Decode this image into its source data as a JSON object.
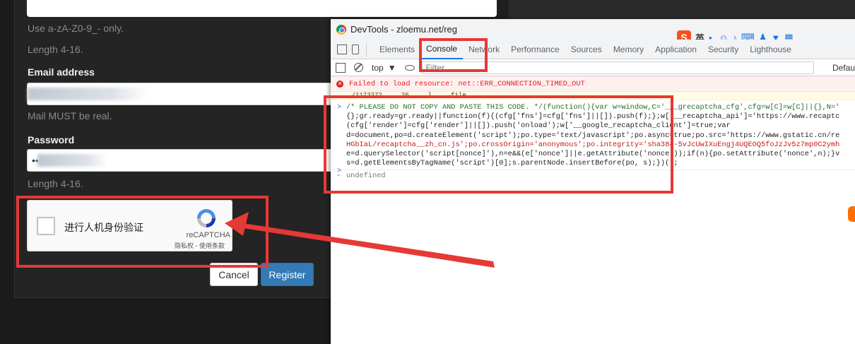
{
  "reg_form": {
    "username_hint": "Use a-zA-Z0-9_- only.",
    "username_length": "Length 4-16.",
    "email_label": "Email address",
    "email_hint": "Mail MUST be real.",
    "password_label": "Password",
    "password_dots": "••",
    "password_length": "Length 4-16.",
    "captcha": {
      "checkbox_label": "进行人机身份验证",
      "brand": "reCAPTCHA",
      "links": "隐私权 - 使用条款"
    },
    "cancel_label": "Cancel",
    "register_label": "Register"
  },
  "devtools": {
    "title": "DevTools - zloemu.net/reg",
    "ime_toolbar": {
      "logo": "S",
      "text": "英",
      "icons": [
        "punctuation-icon",
        "emoji-icon",
        "microphone-icon",
        "keyboard-icon",
        "user-icon",
        "shirt-icon",
        "grid-icon"
      ]
    },
    "tabs": [
      "Elements",
      "Console",
      "Network",
      "Performance",
      "Sources",
      "Memory",
      "Application",
      "Security",
      "Lighthouse"
    ],
    "active_tab": "Console",
    "context": "top",
    "filter_placeholder": "Filter",
    "levels": "Defau",
    "console": {
      "error": "Failed to load resource: net::ERR_CONNECTION_TIMED_OUT",
      "warning": "   ... /1173372 ... 26 ... l  ... file ... ... ... ...",
      "code_lines": [
        "/* PLEASE DO NOT COPY AND PASTE THIS CODE. */(function(){var w=window,C='___grecaptcha_cfg',cfg=w[C]=w[C]||{},N='",
        "{};gr.ready=gr.ready||function(f){(cfg['fns']=cfg['fns']||[]).push(f);};w['__recaptcha_api']='https://www.recaptc",
        "(cfg['render']=cfg['render']||[]).push('onload');w['__google_recaptcha_client']=true;var",
        "d=document,po=d.createElement('script');po.type='text/javascript';po.async=true;po.src='https://www.gstatic.cn/re",
        "HGbIaL/recaptcha__zh_cn.js';po.crossOrigin='anonymous';po.integrity='sha384-5vJcUwIXuEngj4UQEOQ5foJzJv5z7mp0C2ymh",
        "e=d.querySelector('script[nonce]'),n=e&&(e['nonce']||e.getAttribute('nonce'));if(n){po.setAttribute('nonce',n);}v",
        "s=d.getElementsByTagName('script')[0];s.parentNode.insertBefore(po, s);})();"
      ],
      "result": "undefined"
    }
  },
  "colors": {
    "annotation_red": "#e53935",
    "register_blue": "#337ab7",
    "active_tab_blue": "#1a73e8",
    "error_red": "#e0201d"
  }
}
